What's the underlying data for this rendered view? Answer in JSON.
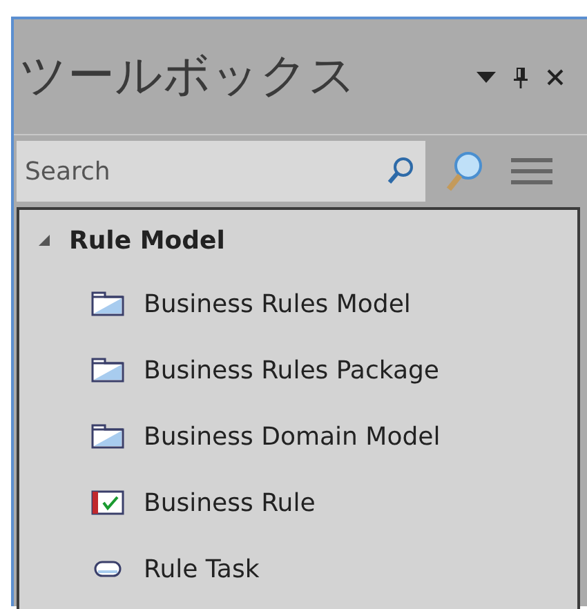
{
  "window": {
    "title": "ツールボックス"
  },
  "search": {
    "placeholder": "Search"
  },
  "groups": [
    {
      "label": "Rule Model",
      "expanded": true,
      "items": [
        {
          "label": "Business Rules Model",
          "kind": "package"
        },
        {
          "label": "Business Rules Package",
          "kind": "package"
        },
        {
          "label": "Business Domain Model",
          "kind": "package"
        },
        {
          "label": "Business Rule",
          "kind": "rule"
        },
        {
          "label": "Rule Task",
          "kind": "task"
        }
      ]
    }
  ]
}
